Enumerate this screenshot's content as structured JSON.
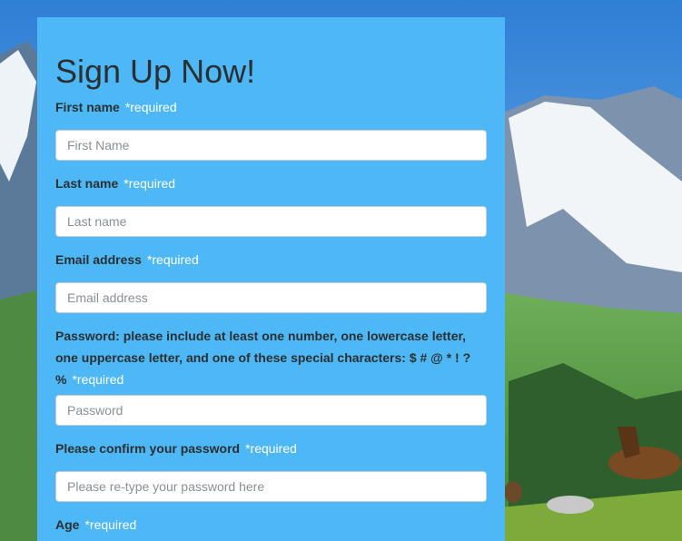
{
  "form": {
    "title": "Sign Up Now!",
    "required_marker": "*required",
    "fields": [
      {
        "label": "First name",
        "placeholder": "First Name"
      },
      {
        "label": "Last name",
        "placeholder": "Last name"
      },
      {
        "label": "Email address",
        "placeholder": "Email address"
      },
      {
        "label": "Password: please include at least one number, one lowercase letter, one uppercase letter, and one of these special characters: $ # @ * ! ? %",
        "placeholder": "Password"
      },
      {
        "label": "Please confirm your password",
        "placeholder": "Please re-type your password here"
      },
      {
        "label": "Age"
      }
    ]
  },
  "colors": {
    "panel": "#4db8f5",
    "required": "#ffffff",
    "label": "#2b2f33"
  }
}
